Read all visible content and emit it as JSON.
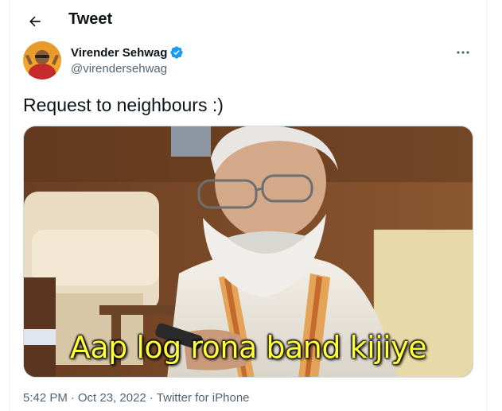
{
  "header": {
    "title": "Tweet",
    "back_icon": "arrow-left-icon"
  },
  "author": {
    "display_name": "Virender Sehwag",
    "handle": "@virendersehwag",
    "verified_icon": "verified-badge-icon",
    "verified_color": "#1d9bf0",
    "more_icon": "more-horizontal-icon"
  },
  "tweet": {
    "text": "Request to neighbours :)",
    "media_caption": "Aap log rona band kijiye"
  },
  "meta": {
    "time": "5:42 PM",
    "sep1": "·",
    "date": "Oct 23, 2022",
    "sep2": "·",
    "source": "Twitter for iPhone"
  },
  "colors": {
    "text_primary": "#0f1419",
    "text_secondary": "#536471",
    "caption_yellow": "#ffff3a",
    "border": "#eff3f4"
  }
}
